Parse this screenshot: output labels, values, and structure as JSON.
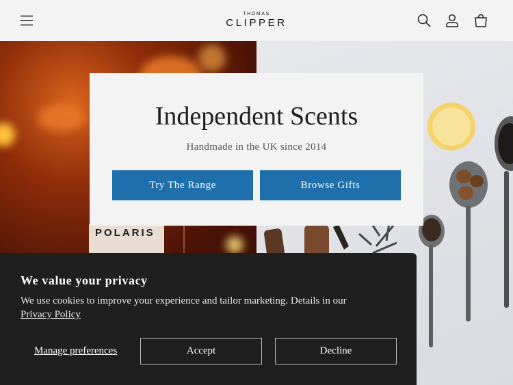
{
  "header": {
    "menu_icon": "hamburger-menu-icon",
    "logo_top": "THOMAS",
    "logo_main": "CLIPPER",
    "icons": [
      "search-icon",
      "account-icon",
      "cart-icon"
    ]
  },
  "hero": {
    "title": "Independent Scents",
    "subtitle": "Handmade in the UK since 2014",
    "primary_cta": "Try The Range",
    "secondary_cta": "Browse Gifts",
    "product_label": "POLARIS"
  },
  "cookie_banner": {
    "title": "We value your privacy",
    "text": "We use cookies to improve your experience and tailor marketing. Details in our",
    "link": "Privacy Policy",
    "manage": "Manage preferences",
    "accept": "Accept",
    "decline": "Decline"
  },
  "colors": {
    "accent": "#1f6fad",
    "banner_bg": "#1f1f1f",
    "page_bg": "#f3f3f3"
  }
}
